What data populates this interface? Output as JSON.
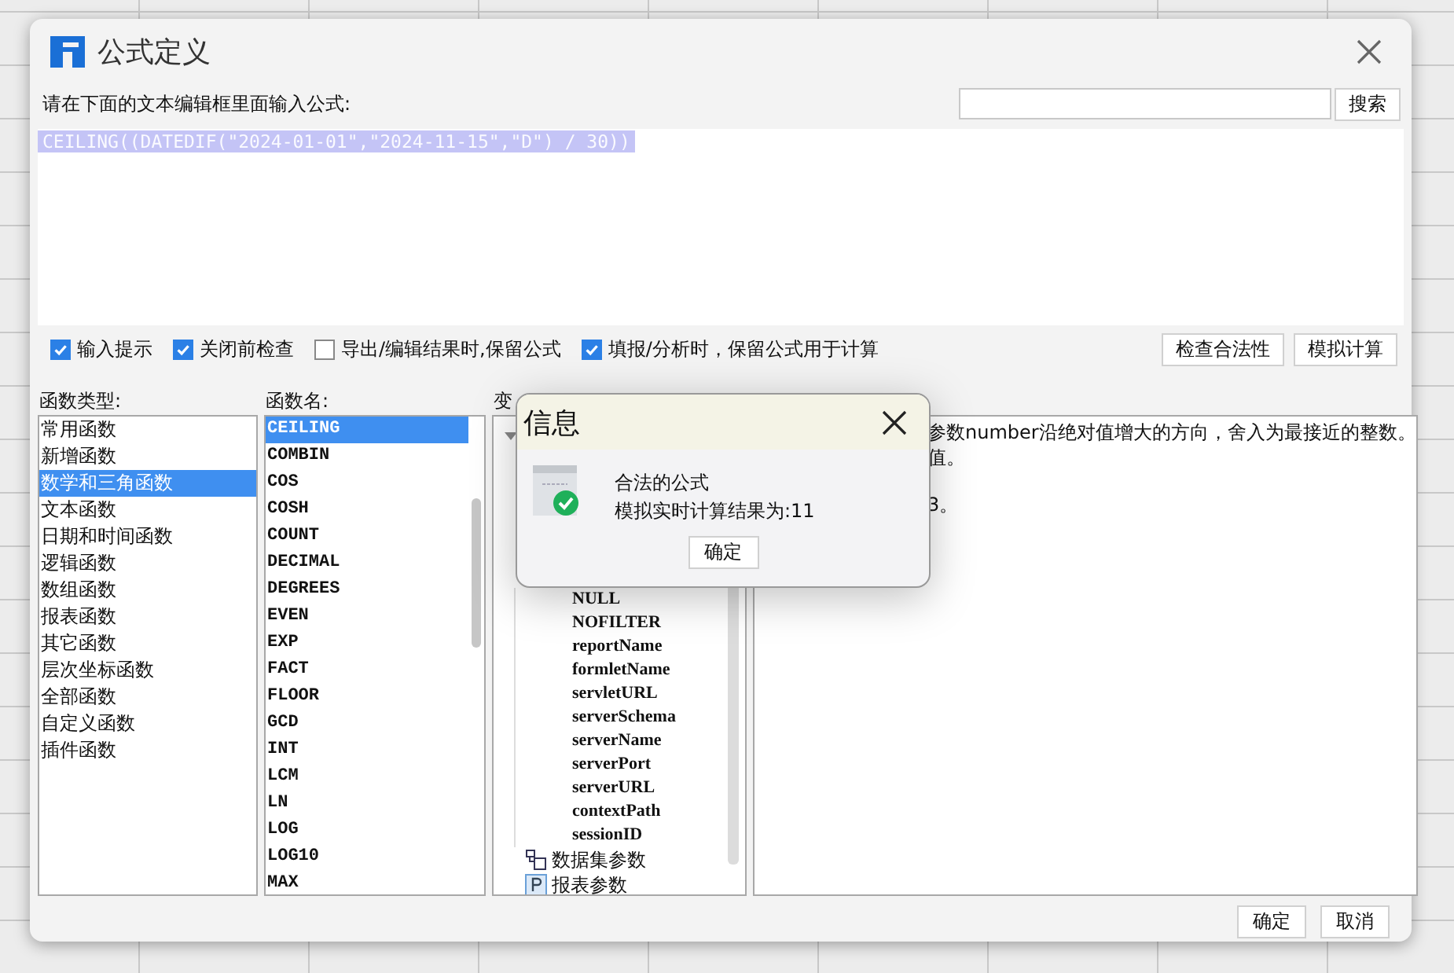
{
  "window": {
    "title": "公式定义"
  },
  "prompt": "请在下面的文本编辑框里面输入公式:",
  "search": {
    "button": "搜索"
  },
  "formula": {
    "value": "CEILING((DATEDIF(\"2024-01-01\",\"2024-11-15\",\"D\") / 30))",
    "selected": true
  },
  "options": [
    {
      "label": "输入提示",
      "checked": true
    },
    {
      "label": "关闭前检查",
      "checked": true
    },
    {
      "label": "导出/编辑结果时,保留公式",
      "checked": false
    },
    {
      "label": "填报/分析时，保留公式用于计算",
      "checked": true
    }
  ],
  "tool_buttons": [
    "检查合法性",
    "模拟计算"
  ],
  "function_types": {
    "heading": "函数类型:",
    "items": [
      {
        "label": "常用函数",
        "selected": false
      },
      {
        "label": "新增函数",
        "selected": false
      },
      {
        "label": "数学和三角函数",
        "selected": true
      },
      {
        "label": "文本函数",
        "selected": false
      },
      {
        "label": "日期和时间函数",
        "selected": false
      },
      {
        "label": "逻辑函数",
        "selected": false
      },
      {
        "label": "数组函数",
        "selected": false
      },
      {
        "label": "报表函数",
        "selected": false
      },
      {
        "label": "其它函数",
        "selected": false
      },
      {
        "label": "层次坐标函数",
        "selected": false
      },
      {
        "label": "全部函数",
        "selected": false
      },
      {
        "label": "自定义函数",
        "selected": false
      },
      {
        "label": "插件函数",
        "selected": false
      }
    ]
  },
  "function_names": {
    "heading": "函数名:",
    "items": [
      {
        "label": "CEILING",
        "selected": true
      },
      {
        "label": "COMBIN",
        "selected": false
      },
      {
        "label": "COS",
        "selected": false
      },
      {
        "label": "COSH",
        "selected": false
      },
      {
        "label": "COUNT",
        "selected": false
      },
      {
        "label": "DECIMAL",
        "selected": false
      },
      {
        "label": "DEGREES",
        "selected": false
      },
      {
        "label": "EVEN",
        "selected": false
      },
      {
        "label": "EXP",
        "selected": false
      },
      {
        "label": "FACT",
        "selected": false
      },
      {
        "label": "FLOOR",
        "selected": false
      },
      {
        "label": "GCD",
        "selected": false
      },
      {
        "label": "INT",
        "selected": false
      },
      {
        "label": "LCM",
        "selected": false
      },
      {
        "label": "LN",
        "selected": false
      },
      {
        "label": "LOG",
        "selected": false
      },
      {
        "label": "LOG10",
        "selected": false
      },
      {
        "label": "MAX",
        "selected": false
      }
    ]
  },
  "variables": {
    "heading": "变",
    "tree": [
      {
        "kind": "group",
        "expanded": true,
        "children": [
          {
            "label": "NULL"
          },
          {
            "label": "NOFILTER"
          },
          {
            "label": "reportName"
          },
          {
            "label": "formletName"
          },
          {
            "label": "servletURL"
          },
          {
            "label": "serverSchema"
          },
          {
            "label": "serverName"
          },
          {
            "label": "serverPort"
          },
          {
            "label": "serverURL"
          },
          {
            "label": "contextPath"
          },
          {
            "label": "sessionID"
          }
        ]
      },
      {
        "kind": "dataset",
        "label": "数据集参数"
      },
      {
        "kind": "param",
        "label": "报表参数"
      }
    ]
  },
  "description": {
    "lines": [
      "参数number沿绝对值增大的方向，舍入为最接近的整数。",
      "值。",
      "3。"
    ]
  },
  "footer_buttons": [
    "确定",
    "取消"
  ],
  "message": {
    "title": "信息",
    "lines": [
      "合法的公式",
      "模拟实时计算结果为:11"
    ],
    "button": "确定"
  }
}
